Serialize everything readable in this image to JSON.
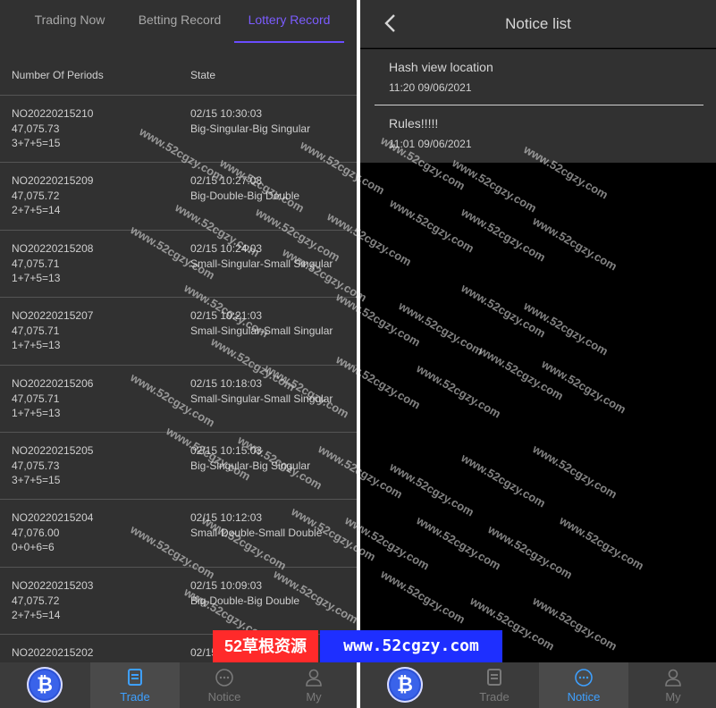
{
  "tabs": [
    {
      "label": "Trading Now",
      "active": false
    },
    {
      "label": "Betting Record",
      "active": false
    },
    {
      "label": "Lottery Record",
      "active": true
    }
  ],
  "columns": {
    "periods": "Number Of Periods",
    "state": "State"
  },
  "records": [
    {
      "period": "NO20220215210",
      "price": "47,075.73",
      "sum": "3+7+5=15",
      "time": "02/15 10:30:03",
      "state": "Big-Singular-Big Singular"
    },
    {
      "period": "NO20220215209",
      "price": "47,075.72",
      "sum": "2+7+5=14",
      "time": "02/15 10:27:03",
      "state": "Big-Double-Big Double"
    },
    {
      "period": "NO20220215208",
      "price": "47,075.71",
      "sum": "1+7+5=13",
      "time": "02/15 10:24:03",
      "state": "Small-Singular-Small Singular"
    },
    {
      "period": "NO20220215207",
      "price": "47,075.71",
      "sum": "1+7+5=13",
      "time": "02/15 10:21:03",
      "state": "Small-Singular-Small Singular"
    },
    {
      "period": "NO20220215206",
      "price": "47,075.71",
      "sum": "1+7+5=13",
      "time": "02/15 10:18:03",
      "state": "Small-Singular-Small Singular"
    },
    {
      "period": "NO20220215205",
      "price": "47,075.73",
      "sum": "3+7+5=15",
      "time": "02/15 10:15:03",
      "state": "Big-Singular-Big Singular"
    },
    {
      "period": "NO20220215204",
      "price": "47,076.00",
      "sum": "0+0+6=6",
      "time": "02/15 10:12:03",
      "state": "Small-Double-Small Double"
    },
    {
      "period": "NO20220215203",
      "price": "47,075.72",
      "sum": "2+7+5=14",
      "time": "02/15 10:09:03",
      "state": "Big-Double-Big Double"
    },
    {
      "period": "NO20220215202",
      "price": "",
      "sum": "",
      "time": "02/15",
      "state": ""
    }
  ],
  "left_nav": {
    "items": [
      {
        "label": "",
        "icon": "bitcoin-logo"
      },
      {
        "label": "Trade",
        "icon": "document-icon",
        "active": true
      },
      {
        "label": "Notice",
        "icon": "chat-icon",
        "active": false
      },
      {
        "label": "My",
        "icon": "user-icon",
        "active": false
      }
    ]
  },
  "right_header": {
    "title": "Notice list",
    "back_icon": "chevron-left-icon"
  },
  "notices": [
    {
      "title": "Hash view location",
      "date": "11:20 09/06/2021"
    },
    {
      "title": "Rules!!!!!",
      "date": "11:01 09/06/2021"
    }
  ],
  "right_nav": {
    "items": [
      {
        "label": "",
        "icon": "bitcoin-logo"
      },
      {
        "label": "Trade",
        "icon": "document-icon",
        "active": false
      },
      {
        "label": "Notice",
        "icon": "chat-icon",
        "active": true
      },
      {
        "label": "My",
        "icon": "user-icon",
        "active": false
      }
    ]
  },
  "watermark": {
    "text": "www.52cgzy.com",
    "banner_left": "52草根资源",
    "banner_right": "www.52cgzy.com"
  },
  "colors": {
    "panel_bg": "#313131",
    "accent_tab": "#7b5cff",
    "nav_active": "#3ea0ff",
    "banner_red": "#ff2a2a",
    "banner_blue": "#1e2fff"
  }
}
